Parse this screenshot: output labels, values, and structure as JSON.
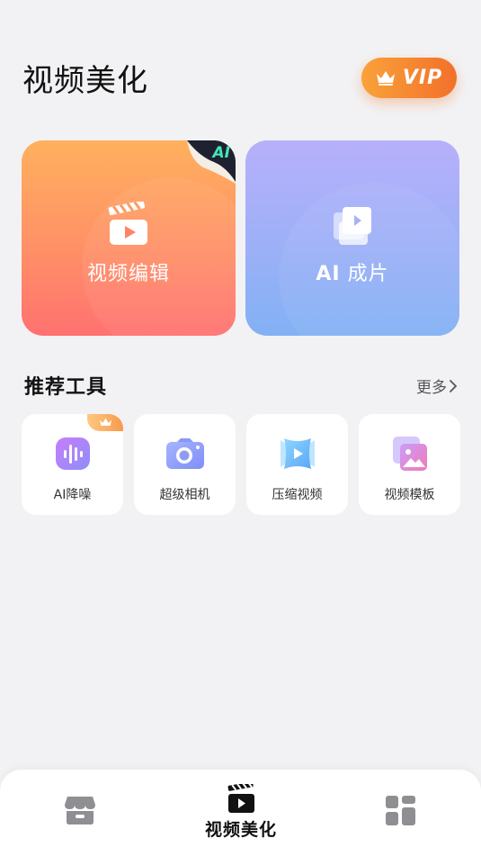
{
  "header": {
    "title": "视频美化",
    "vip_label": "VIP"
  },
  "cards": [
    {
      "label": "视频编辑",
      "badge": "AI",
      "icon": "clapperboard-icon"
    },
    {
      "label_ai": "AI",
      "label_rest": " 成片",
      "icon": "video-stack-icon"
    }
  ],
  "section": {
    "title": "推荐工具",
    "more_label": "更多"
  },
  "tools": [
    {
      "label": "AI降噪",
      "icon": "audio-wave-icon",
      "badge": "crown-icon"
    },
    {
      "label": "超级相机",
      "icon": "camera-icon"
    },
    {
      "label": "压缩视频",
      "icon": "compress-video-icon"
    },
    {
      "label": "视频模板",
      "icon": "template-image-icon"
    }
  ],
  "nav": {
    "items": [
      {
        "icon": "store-icon",
        "label": ""
      },
      {
        "icon": "clapperboard-icon",
        "label": "视频美化",
        "active": true
      },
      {
        "icon": "grid-apps-icon",
        "label": ""
      }
    ]
  },
  "colors": {
    "background": "#f2f2f4",
    "vip_gradient_start": "#f9a23a",
    "vip_gradient_end": "#f3702a",
    "edit_card_top": "#ffb05e",
    "edit_card_bottom": "#ff7170",
    "ai_card_top": "#b7b0fb",
    "ai_card_bottom": "#82b1f4"
  }
}
